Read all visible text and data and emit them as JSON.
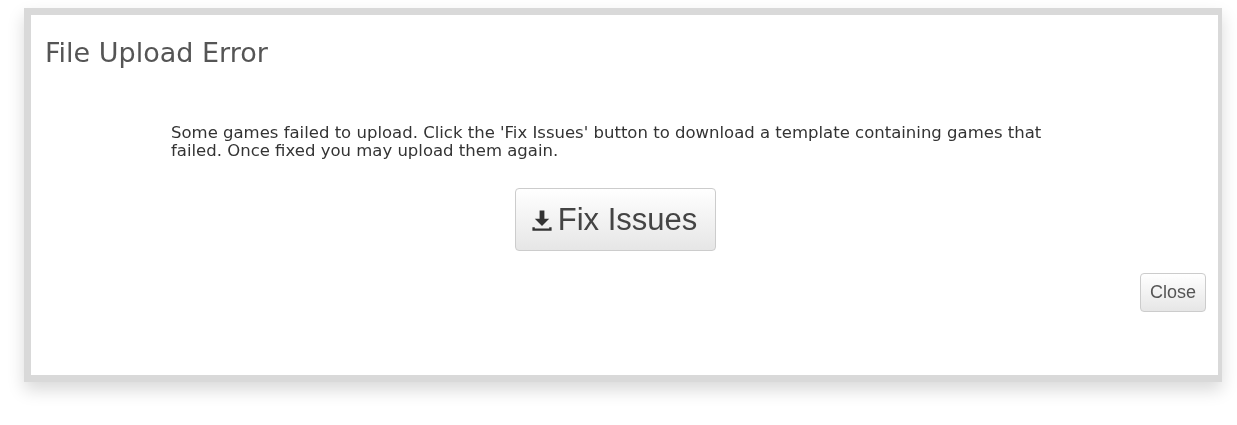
{
  "dialog": {
    "title": "File Upload Error",
    "message": "Some games failed to upload. Click the 'Fix Issues' button to download a template containing games that failed. Once fixed you may upload them again.",
    "primary_button": {
      "label": "Fix Issues"
    },
    "close_button": {
      "label": "Close"
    }
  }
}
